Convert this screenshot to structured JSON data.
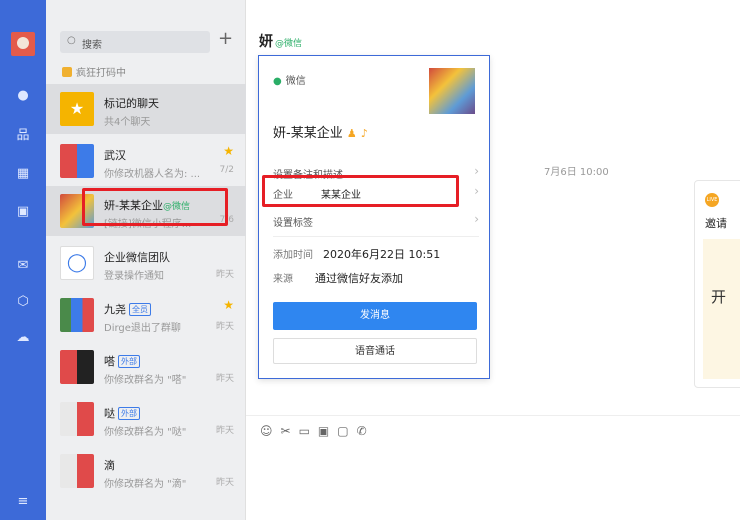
{
  "search": {
    "icon": "search-icon",
    "placeholder": "搜索"
  },
  "status_text": "疯狂打码中",
  "chats": [
    {
      "name": "标记的聊天",
      "sub": "共4个聊天",
      "time": "",
      "star": false,
      "badge": "",
      "wx": ""
    },
    {
      "name": "武汉",
      "sub": "你修改机器人名为: ...",
      "time": "7/2",
      "star": true,
      "badge": "",
      "wx": ""
    },
    {
      "name": "妍-某某企业",
      "sub": "[链接]微信小程序...",
      "time": "7/6",
      "star": false,
      "badge": "",
      "wx": "@微信"
    },
    {
      "name": "企业微信团队",
      "sub": "登录操作通知",
      "time": "昨天",
      "star": false,
      "badge": "",
      "wx": ""
    },
    {
      "name": "九尧",
      "sub": "Dirge退出了群聊",
      "time": "昨天",
      "star": true,
      "badge": "全员",
      "wx": ""
    },
    {
      "name": "嗒",
      "sub": "你修改群名为 \"嗒\"",
      "time": "昨天",
      "star": false,
      "badge": "外部",
      "wx": ""
    },
    {
      "name": "哒",
      "sub": "你修改群名为 \"哒\"",
      "time": "昨天",
      "star": false,
      "badge": "外部",
      "wx": ""
    },
    {
      "name": "滴",
      "sub": "你修改群名为 \"滴\"",
      "time": "昨天",
      "star": false,
      "badge": "",
      "wx": ""
    }
  ],
  "header": {
    "title": "妍",
    "wx": "@微信"
  },
  "date_divider": "7月6日 10:00",
  "right_card": {
    "title": "邀请",
    "big": "开"
  },
  "popup": {
    "source_tag": "微信",
    "name": "妍-某某企业",
    "rows": [
      {
        "label": "设置备注和描述",
        "value": ""
      },
      {
        "label": "企业",
        "value": "某某企业"
      },
      {
        "label": "设置标签",
        "value": ""
      }
    ],
    "added_label": "添加时间",
    "added_value": "2020年6月22日 10:51",
    "source_label": "来源",
    "source_value": "通过微信好友添加",
    "send_button": "发消息",
    "call_button": "语音通话"
  },
  "colors": {
    "rail": "#3d6ad8",
    "accent": "#2f86f0",
    "highlight": "#e61e25",
    "wechat": "#2aae67"
  }
}
